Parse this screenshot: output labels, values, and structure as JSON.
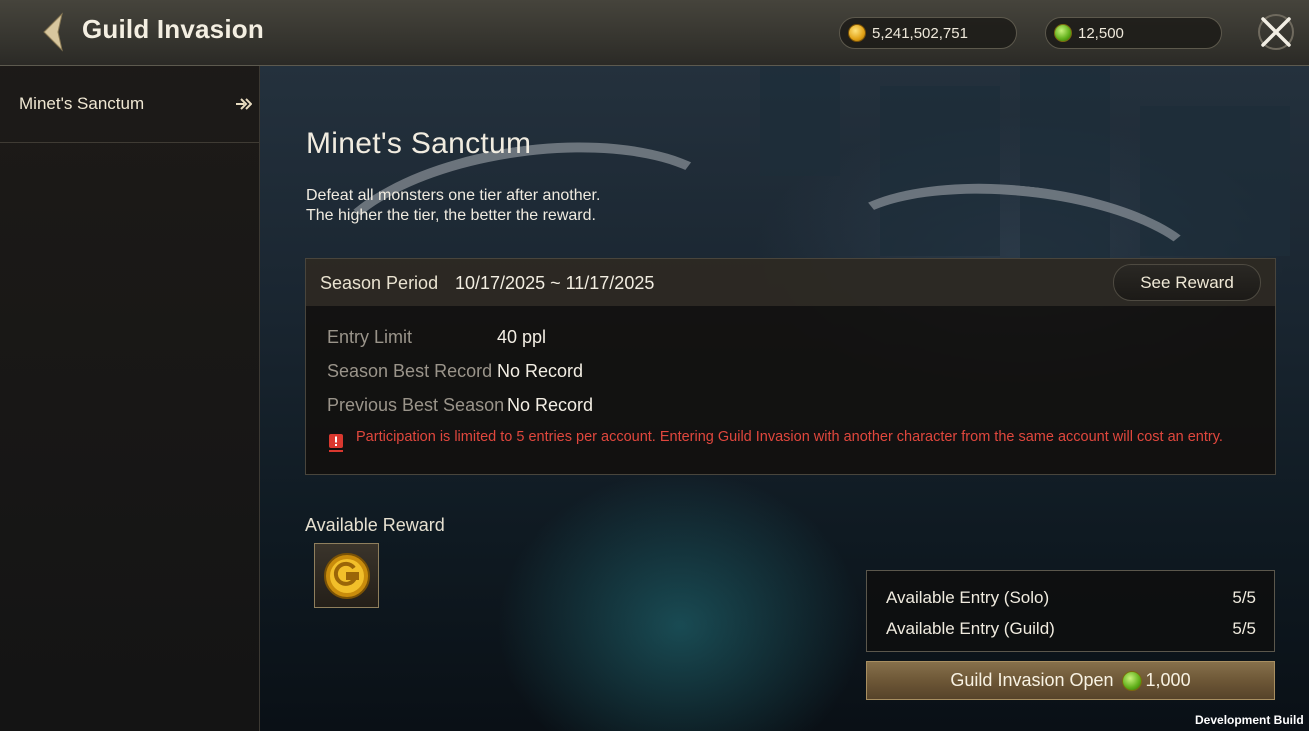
{
  "header": {
    "title": "Guild Invasion",
    "currencies": [
      {
        "icon": "gold-coin-icon",
        "value": "5,241,502,751"
      },
      {
        "icon": "green-gem-icon",
        "value": "12,500"
      }
    ]
  },
  "sidebar": {
    "items": [
      {
        "label": "Minet's Sanctum",
        "selected": true
      }
    ]
  },
  "main": {
    "title": "Minet's Sanctum",
    "description": [
      "Defeat all monsters one tier after another.",
      "The higher the tier, the better the reward."
    ],
    "season": {
      "label": "Season Period",
      "value": "10/17/2025 ~ 11/17/2025",
      "see_reward_label": "See Reward"
    },
    "info": [
      {
        "key": "Entry Limit",
        "value": "40 ppl"
      },
      {
        "key": "Season Best Record",
        "value": "No Record"
      },
      {
        "key": "Previous Best Season",
        "value": "No Record"
      }
    ],
    "warning": "Participation is limited to 5 entries per account. Entering Guild Invasion with another character from the same account will cost an entry.",
    "available_reward_label": "Available Reward",
    "entries": [
      {
        "label": "Available Entry (Solo)",
        "value": "5/5"
      },
      {
        "label": "Available Entry (Guild)",
        "value": "5/5"
      }
    ],
    "open_button": {
      "label": "Guild Invasion Open",
      "cost": "1,000"
    }
  },
  "footer": {
    "build": "Development Build"
  },
  "colors": {
    "warning": "#e0473d",
    "gold": "#e2a317",
    "green": "#5fae19"
  }
}
